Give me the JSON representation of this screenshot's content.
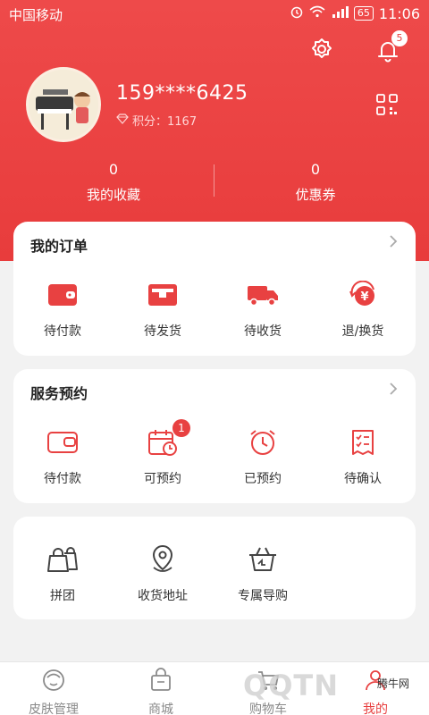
{
  "status_bar": {
    "carrier": "中国移动",
    "battery": "65",
    "time": "11:06"
  },
  "header": {
    "notification_count": "5",
    "phone": "159****6425",
    "points_text": "积分：1167"
  },
  "stats": [
    {
      "value": "0",
      "label": "我的收藏"
    },
    {
      "value": "0",
      "label": "优惠券"
    }
  ],
  "orders": {
    "title": "我的订单",
    "items": [
      {
        "label": "待付款",
        "icon": "wallet-icon"
      },
      {
        "label": "待发货",
        "icon": "card-icon"
      },
      {
        "label": "待收货",
        "icon": "truck-icon"
      },
      {
        "label": "退/换货",
        "icon": "refund-icon"
      }
    ]
  },
  "services": {
    "title": "服务预约",
    "items": [
      {
        "label": "待付款",
        "icon": "wallet-icon"
      },
      {
        "label": "可预约",
        "icon": "calendar-icon",
        "badge": "1"
      },
      {
        "label": "已预约",
        "icon": "alarm-icon"
      },
      {
        "label": "待确认",
        "icon": "checklist-icon"
      }
    ]
  },
  "tools": {
    "items": [
      {
        "label": "拼团",
        "icon": "group-bag-icon"
      },
      {
        "label": "收货地址",
        "icon": "location-icon"
      },
      {
        "label": "专属导购",
        "icon": "basket-icon"
      }
    ]
  },
  "tabbar": {
    "items": [
      {
        "label": "皮肤管理",
        "icon": "face-icon"
      },
      {
        "label": "商城",
        "icon": "shop-icon"
      },
      {
        "label": "购物车",
        "icon": "cart-icon"
      },
      {
        "label": "我的",
        "icon": "person-icon"
      }
    ]
  },
  "watermark": {
    "logo_text": "QQTN",
    "site_text": "腾牛网"
  },
  "colors": {
    "brand": "#e84141"
  }
}
